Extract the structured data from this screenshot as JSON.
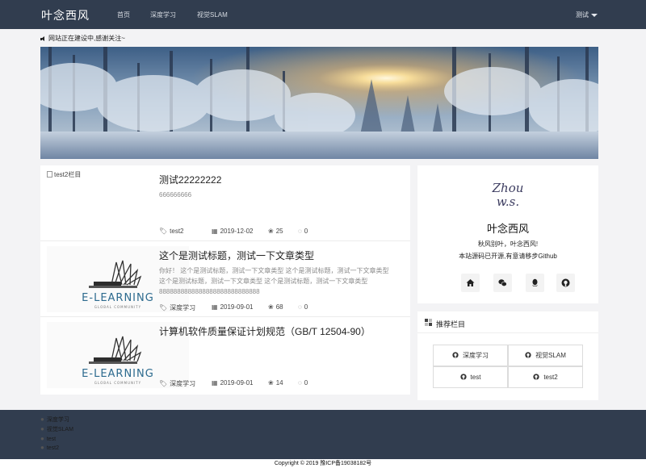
{
  "navbar": {
    "brand": "叶念西风",
    "items": [
      "首页",
      "深度学习",
      "视觉SLAM"
    ],
    "user_menu": "测试"
  },
  "notice": "网站正在建设中,感谢关注~",
  "articles": [
    {
      "image_alt": "test2栏目",
      "title": "测试22222222",
      "desc": "666666666",
      "category": "test2",
      "date": "2019-12-02",
      "views": "25",
      "comments": "0"
    },
    {
      "image_text": "E-LEARNING",
      "image_subtext": "GLOBAL COMMUNITY",
      "title": "这个是测试标题，测试一下文章类型",
      "desc": "你好！ 这个是测试标题，测试一下文章类型 这个是测试标题，测试一下文章类型 这个是测试标题，测试一下文章类型 这个是测试标题，测试一下文章类型 8888888888888888888888888888",
      "category": "深度学习",
      "date": "2019-09-01",
      "views": "68",
      "comments": "0"
    },
    {
      "image_text": "E-LEARNING",
      "image_subtext": "GLOBAL COMMUNITY",
      "title": "计算机软件质量保证计划规范（GB/T 12504-90）",
      "desc": "",
      "category": "深度学习",
      "date": "2019-09-01",
      "views": "14",
      "comments": "0"
    }
  ],
  "profile": {
    "signature_line1": "Zhou",
    "signature_line2": "w.s.",
    "name": "叶念西风",
    "motto": "秋风别叶，叶念西风!",
    "note": "本站源码已开源,有意请移步Github",
    "socials": [
      "home-icon",
      "wechat-icon",
      "qq-icon",
      "github-icon"
    ]
  },
  "recommend": {
    "title": "推荐栏目",
    "items": [
      "深度学习",
      "视觉SLAM",
      "test",
      "test2"
    ]
  },
  "footer": {
    "links": [
      "深度学习",
      "视觉SLAM",
      "test",
      "test2"
    ],
    "copyright": "Copyright © 2019  豫ICP备19038182号"
  },
  "colors": {
    "navbar": "#313d4f",
    "background": "#f3f3f5"
  }
}
